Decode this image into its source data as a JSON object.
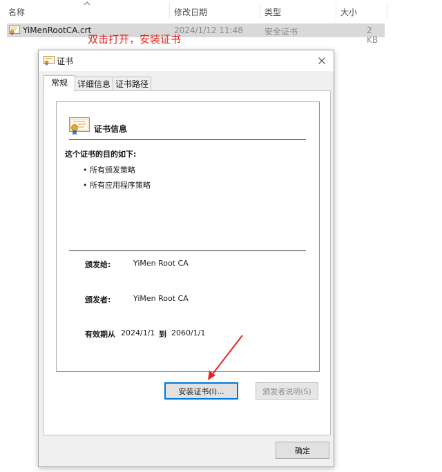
{
  "explorer": {
    "columns": {
      "name": "名称",
      "modified": "修改日期",
      "type": "类型",
      "size": "大小"
    },
    "file": {
      "name": "YiMenRootCA.crt",
      "modified": "2024/1/12 11:48",
      "type": "安全证书",
      "size": "2 KB"
    }
  },
  "annotation": "双击打开，安装证书",
  "dialog": {
    "title": "证书",
    "tabs": [
      "常规",
      "详细信息",
      "证书路径"
    ],
    "info_title": "证书信息",
    "purpose_heading": "这个证书的目的如下:",
    "purposes": [
      "• 所有颁发策略",
      "• 所有应用程序策略"
    ],
    "issued_to_label": "颁发给:",
    "issued_to": "YiMen Root CA",
    "issued_by_label": "颁发者:",
    "issued_by": "YiMen Root CA",
    "validity_label": "有效期从",
    "valid_from": "2024/1/1",
    "to_label": "到",
    "valid_to": "2060/1/1",
    "install_button": "安装证书(I)...",
    "issuer_statement_button": "颁发者说明(S)",
    "ok_button": "确定"
  },
  "colors": {
    "annotation": "#e8231f",
    "accent": "#0078d7"
  }
}
